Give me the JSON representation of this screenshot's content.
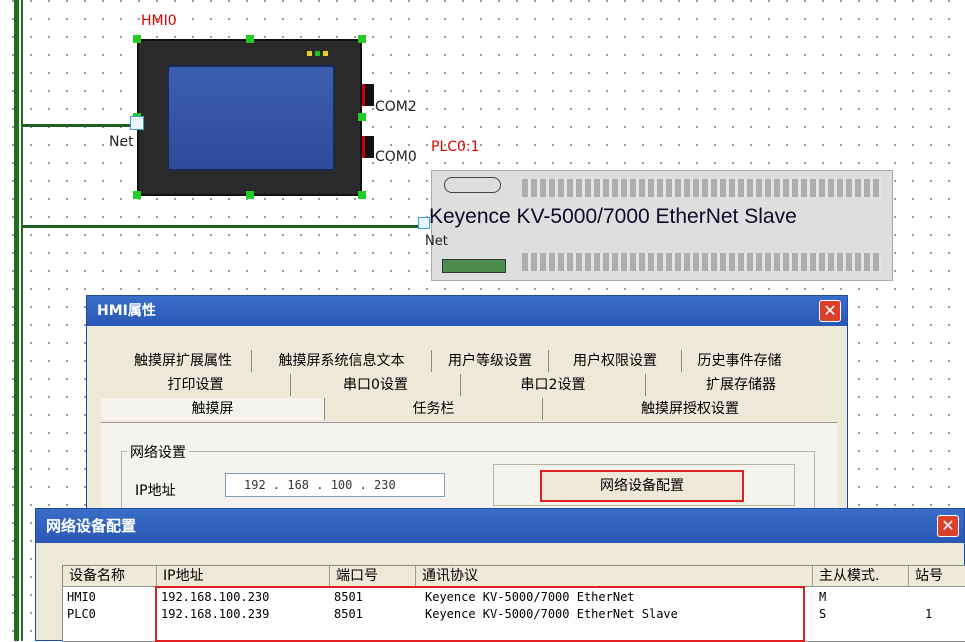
{
  "canvas": {
    "hmi_label": "HMI0",
    "hmi_net_label": "Net",
    "com2_label": "COM2",
    "com0_label": "COM0",
    "plc_label": "PLC0:1",
    "plc_title": "Keyence KV-5000/7000 EtherNet Slave",
    "plc_net_label": "Net"
  },
  "hmi_props": {
    "title": "HMI属性",
    "close_glyph": "✕",
    "tabs_row1": [
      "触摸屏扩展属性",
      "触摸屏系统信息文本",
      "用户等级设置",
      "用户权限设置",
      "历史事件存储"
    ],
    "tabs_row2": [
      "打印设置",
      "串口0设置",
      "串口2设置",
      "扩展存储器"
    ],
    "tabs_row3": [
      "触摸屏",
      "任务栏",
      "触摸屏授权设置"
    ],
    "network_group": "网络设置",
    "ip_label": "IP地址",
    "ip_value": "192 . 168 . 100 . 230",
    "net_config_button": "网络设备配置"
  },
  "net_config": {
    "title": "网络设备配置",
    "close_glyph": "✕",
    "columns": [
      "设备名称",
      "IP地址",
      "端口号",
      "通讯协议",
      "主从模式.",
      "站号"
    ],
    "rows": [
      {
        "name": "HMI0",
        "ip": "192.168.100.230",
        "port": "8501",
        "protocol": "Keyence KV-5000/7000 EtherNet",
        "mode": "M",
        "station": ""
      },
      {
        "name": "PLC0",
        "ip": "192.168.100.239",
        "port": "8501",
        "protocol": "Keyence KV-5000/7000 EtherNet Slave",
        "mode": "S",
        "station": "1"
      }
    ]
  },
  "colors": {
    "wire": "#1f6e1f",
    "highlight": "#e02020",
    "titlebar": "#2a58b5"
  }
}
